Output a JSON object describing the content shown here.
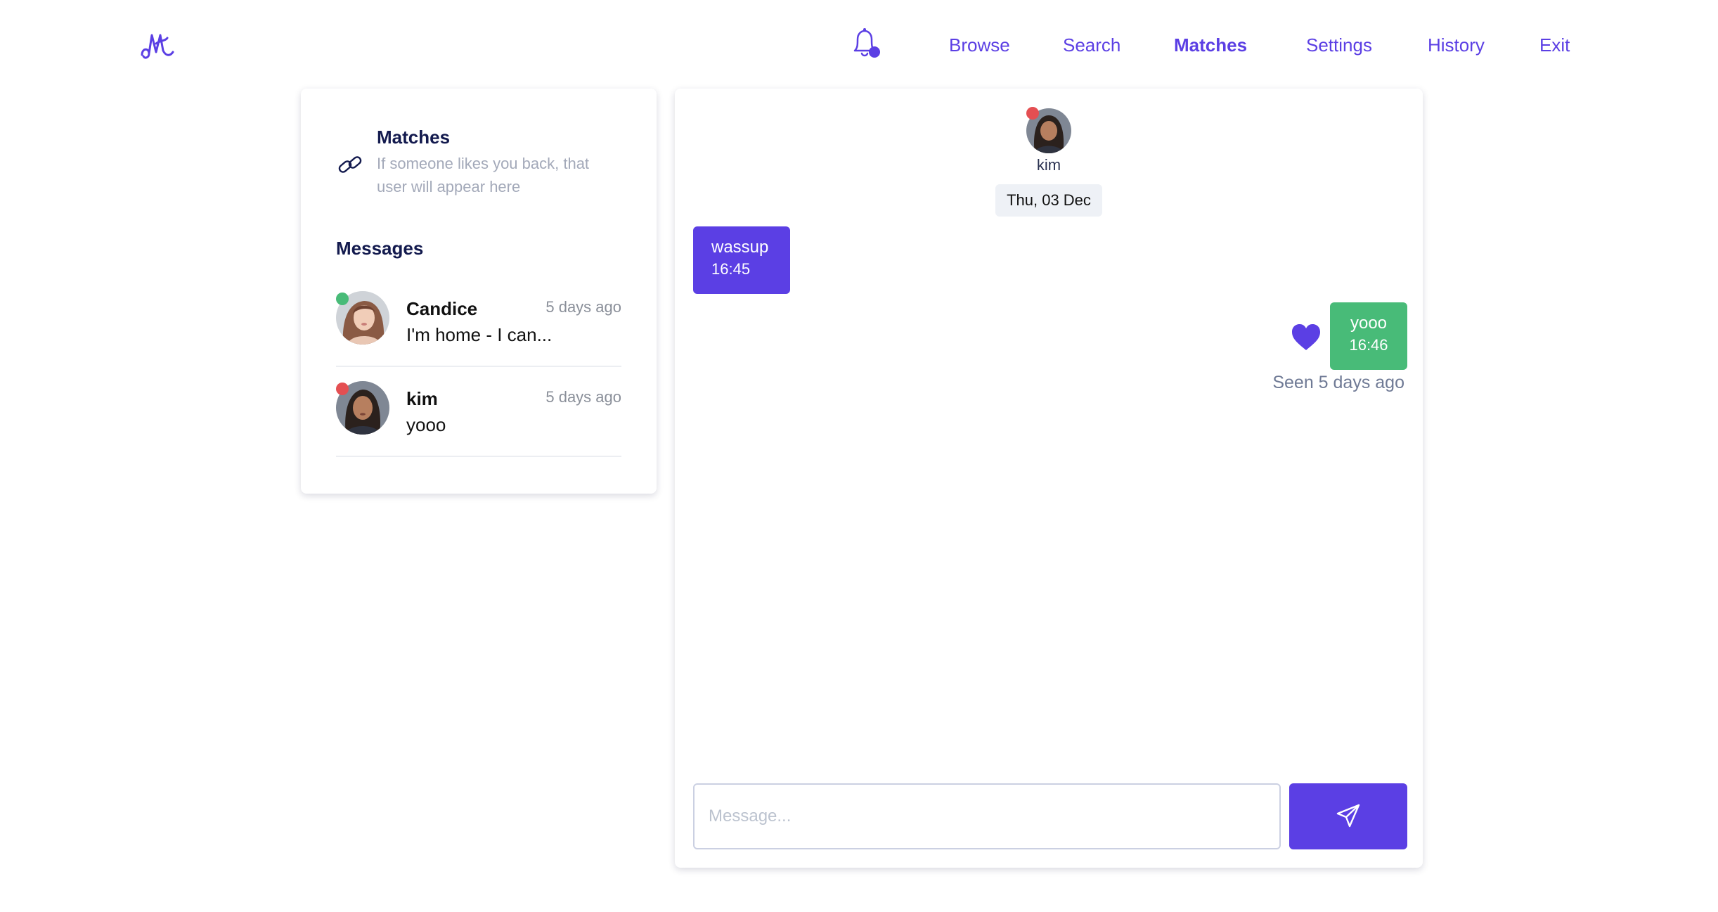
{
  "header": {
    "logo_icon": "mmm-wave-logo",
    "notification_icon": "bell-icon",
    "nav": {
      "browse": "Browse",
      "search": "Search",
      "matches": "Matches",
      "settings": "Settings",
      "history": "History",
      "exit": "Exit"
    },
    "active_nav": "Matches"
  },
  "sidebar": {
    "matches_icon": "link-icon",
    "matches_title": "Matches",
    "matches_subtitle": "If someone likes you back, that user will appear here",
    "messages_title": "Messages",
    "conversations": [
      {
        "name": "Candice",
        "time": "5 days ago",
        "preview": "I'm home - I can...",
        "status_color": "#48bb78"
      },
      {
        "name": "kim",
        "time": "5 days ago",
        "preview": "yooo",
        "status_color": "#e44f52"
      }
    ]
  },
  "chat": {
    "contact_name": "kim",
    "contact_status_color": "#e44f52",
    "date": "Thu, 03 Dec",
    "messages": [
      {
        "direction": "incoming",
        "text": "wassup",
        "time": "16:45",
        "color": "#5b3fe4"
      },
      {
        "direction": "outgoing",
        "text": "yooo",
        "time": "16:46",
        "color": "#48bb78"
      }
    ],
    "seen_text": "Seen 5 days ago",
    "reaction_icon": "heart-icon",
    "input_placeholder": "Message...",
    "send_icon": "send-icon"
  },
  "colors": {
    "accent": "#5b3fe4",
    "online": "#48bb78",
    "offline": "#e44f52",
    "heading": "#131a4e"
  }
}
